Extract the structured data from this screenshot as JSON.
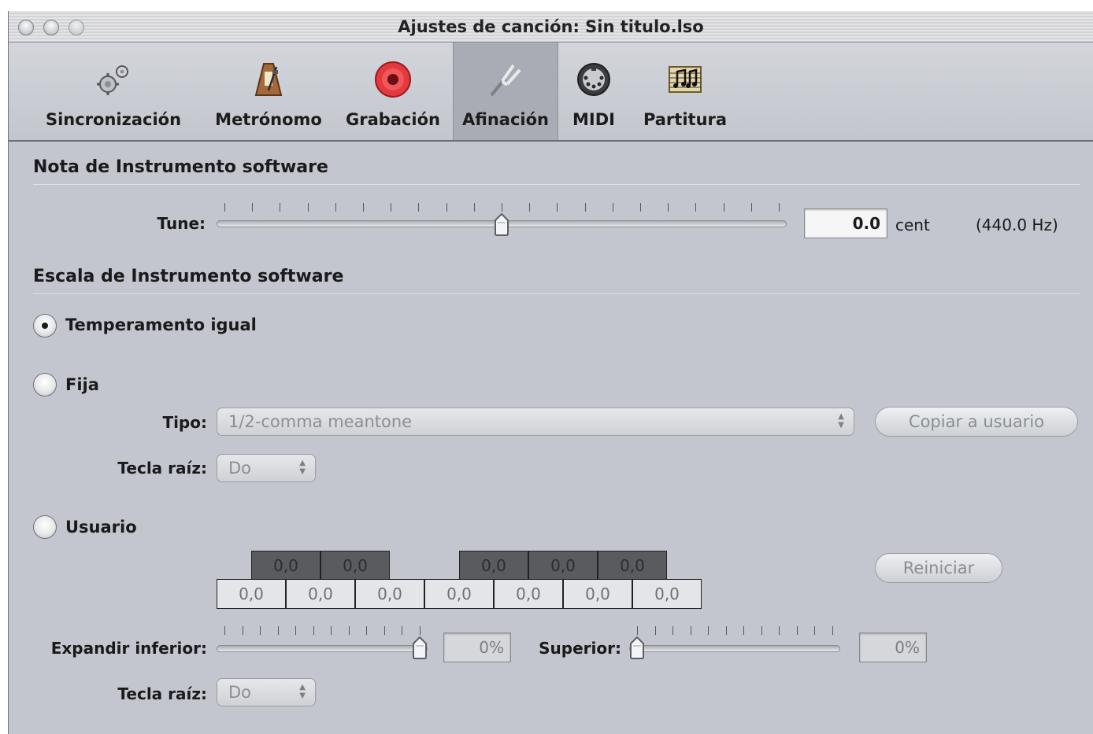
{
  "window": {
    "title": "Ajustes de canción: Sin titulo.lso"
  },
  "toolbar": {
    "items": [
      {
        "label": "Sincronización",
        "icon": "gears-icon"
      },
      {
        "label": "Metrónomo",
        "icon": "metronome-icon"
      },
      {
        "label": "Grabación",
        "icon": "record-icon"
      },
      {
        "label": "Afinación",
        "icon": "tuning-fork-icon",
        "selected": true
      },
      {
        "label": "MIDI",
        "icon": "midi-connector-icon"
      },
      {
        "label": "Partitura",
        "icon": "score-notes-icon"
      }
    ]
  },
  "nota": {
    "section_title": "Nota de Instrumento software",
    "tune_label": "Tune:",
    "tune_value": "0.0",
    "tune_unit": "cent",
    "tune_hz": "(440.0 Hz)",
    "tune_level": 0.5
  },
  "escala": {
    "section_title": "Escala de Instrumento software",
    "selected_mode": "Temperamento igual",
    "opt_equal": "Temperamento igual",
    "opt_fixed": "Fija",
    "tipo_label": "Tipo:",
    "tipo_value": "1/2-comma meantone",
    "copy_button": "Copiar a usuario",
    "root_label": "Tecla raíz:",
    "root_value": "Do",
    "opt_user": "Usuario",
    "black_keys": [
      "0,0",
      "0,0",
      "",
      "0,0",
      "0,0",
      "0,0"
    ],
    "white_keys": [
      "0,0",
      "0,0",
      "0,0",
      "0,0",
      "0,0",
      "0,0",
      "0,0"
    ],
    "reset_button": "Reiniciar",
    "expand_lower_label": "Expandir inferior:",
    "expand_lower_value": "0%",
    "expand_lower_level": 1.0,
    "upper_label": "Superior:",
    "upper_value": "0%",
    "upper_level": 0.0,
    "root2_label": "Tecla raíz:",
    "root2_value": "Do"
  }
}
